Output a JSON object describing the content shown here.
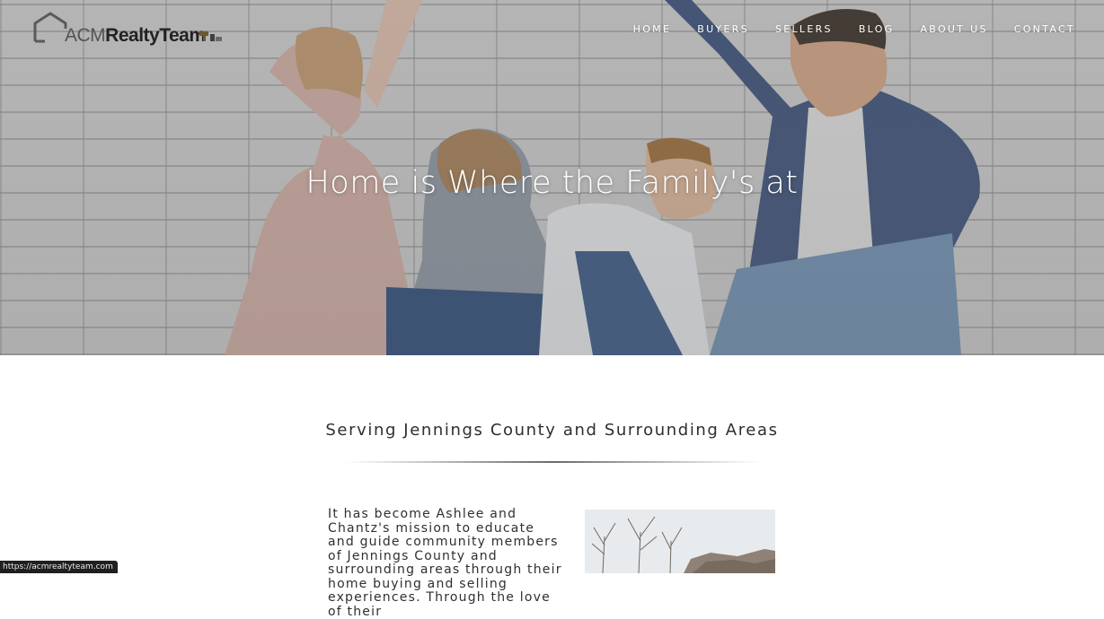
{
  "logo": {
    "acm": "ACM",
    "realty_team": "RealtyTeam"
  },
  "nav": {
    "items": [
      {
        "label": "HOME"
      },
      {
        "label": "BUYERS"
      },
      {
        "label": "SELLERS"
      },
      {
        "label": "BLOG"
      },
      {
        "label": "ABOUT US"
      },
      {
        "label": "CONTACT"
      }
    ]
  },
  "hero": {
    "heading": "Home is Where the Family's at"
  },
  "content": {
    "section_title": "Serving Jennings County and Surrounding Areas",
    "intro_text": "It has become Ashlee and Chantz's mission to educate and guide community members of Jennings County and surrounding areas through their home buying and selling experiences. Through the love of their"
  },
  "status_bar": {
    "url": "https://acmrealtyteam.com"
  },
  "colors": {
    "accent": "#222222",
    "hero_text": "#ffffff",
    "body_text": "#2e2e2e"
  },
  "icons": {
    "logo": "house-outline-icon",
    "badge": "flag-badge-icon"
  }
}
